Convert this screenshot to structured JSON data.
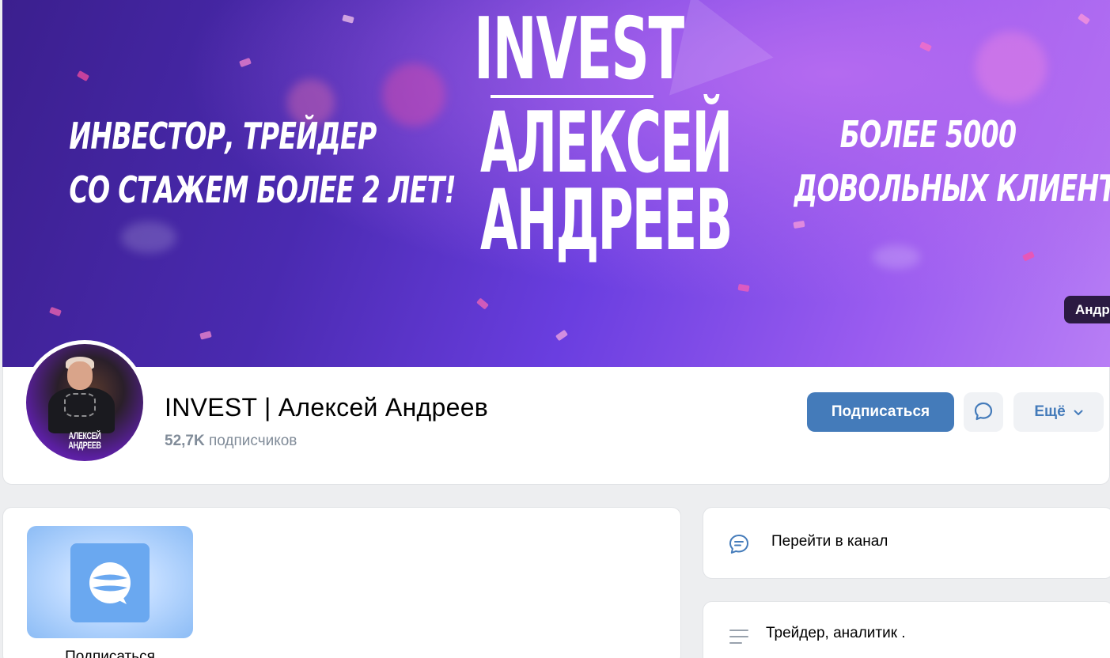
{
  "cover": {
    "left_lines": [
      "ИНВЕСТОР, ТРЕЙДЕР",
      "СО СТАЖЕМ БОЛЕЕ 2 ЛЕТ!"
    ],
    "center_top": "INVEST",
    "center_name_1": "АЛЕКСЕЙ",
    "center_name_2": "АНДРЕЕВ",
    "right_lines": [
      "БОЛЕЕ 5000",
      "ДОВОЛЬНЫХ КЛИЕНТОВ!"
    ],
    "corner_tag": "Андр"
  },
  "header": {
    "title": "INVEST | Алексей Андреев",
    "subscribers_count": "52,7K",
    "subscribers_label": "подписчиков",
    "avatar_text_1": "АЛЕКСЕЙ",
    "avatar_text_2": "АНДРЕЕВ",
    "subscribe_button": "Подписаться",
    "message_icon": "message-bubble-icon",
    "more_button": "Ещё",
    "more_icon": "chevron-down-icon"
  },
  "main": {
    "app_tile_label": "Подписаться",
    "app_icon": "chat-app-logo-icon"
  },
  "sidebar": {
    "channel_icon": "chat-bubble-lines-icon",
    "channel_label": "Перейти в канал",
    "about_icon": "lines-icon",
    "about_text": "Трейдер, аналитик ."
  },
  "colors": {
    "accent": "#447bba",
    "cover_gradient_start": "#3b1f8e",
    "cover_gradient_end": "#b87ef5",
    "secondary_text": "#818c99",
    "page_background": "#edeef0"
  }
}
